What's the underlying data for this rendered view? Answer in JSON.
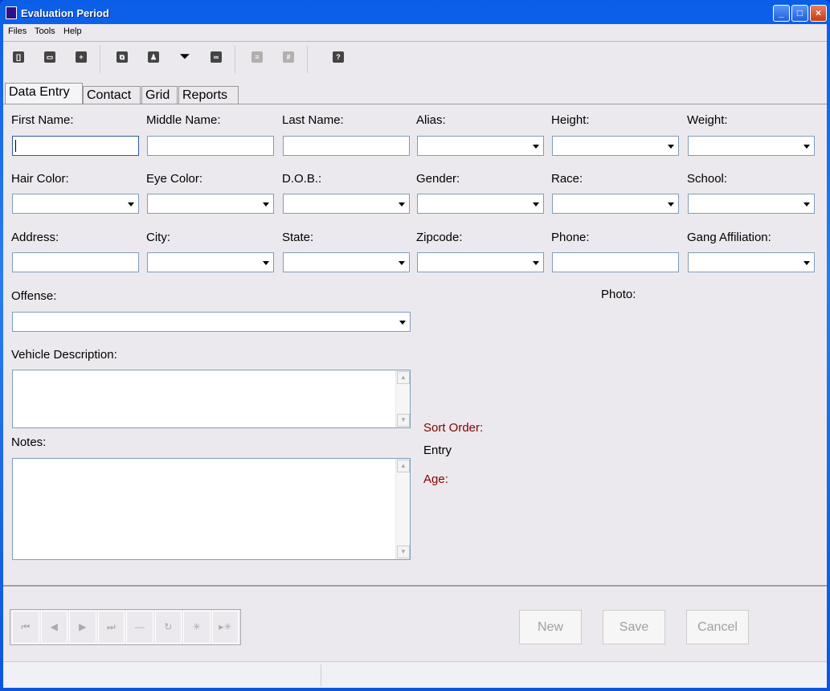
{
  "window": {
    "title": "Evaluation Period"
  },
  "menu": [
    "Files",
    "Tools",
    "Help"
  ],
  "toolbar": {
    "icons": [
      "exit-icon",
      "open-icon",
      "add-record-icon",
      "window-icon",
      "person-icon",
      "filter-icon",
      "binoculars-icon",
      "list-icon",
      "grid-icon",
      "help-icon"
    ]
  },
  "tabs": [
    "Data Entry",
    "Contact",
    "Grid",
    "Reports"
  ],
  "fields": {
    "first_name": "First Name:",
    "middle_name": "Middle Name:",
    "last_name": "Last Name:",
    "alias": "Alias:",
    "height": "Height:",
    "weight": "Weight:",
    "hair_color": "Hair Color:",
    "eye_color": "Eye Color:",
    "dob": "D.O.B.:",
    "gender": "Gender:",
    "race": "Race:",
    "school": "School:",
    "address": "Address:",
    "city": "City:",
    "state": "State:",
    "zipcode": "Zipcode:",
    "phone": "Phone:",
    "gang": "Gang Affiliation:",
    "offense": "Offense:",
    "vehicle": "Vehicle Description:",
    "notes": "Notes:",
    "photo": "Photo:"
  },
  "info": {
    "sort_order_label": "Sort Order:",
    "sort_order_value": "Entry",
    "age_label": "Age:"
  },
  "colors": {
    "accent_label": "#800000"
  },
  "buttons": {
    "new": "New",
    "save": "Save",
    "cancel": "Cancel"
  }
}
